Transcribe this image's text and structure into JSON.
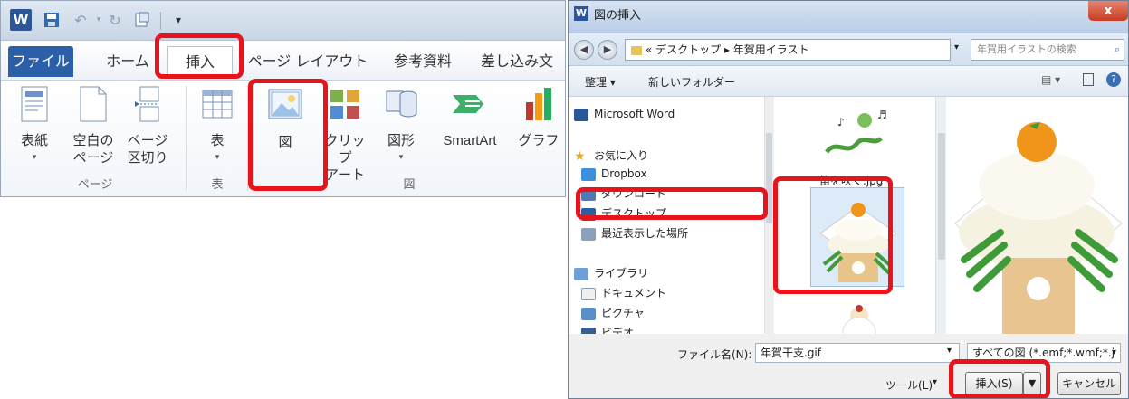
{
  "ribbon": {
    "qat": {
      "app_icon": "W",
      "save_icon": "save-icon",
      "undo_icon": "undo-icon",
      "redo_icon": "redo-icon"
    },
    "tabs": [
      {
        "label": "ファイル"
      },
      {
        "label": "ホーム"
      },
      {
        "label": "挿入"
      },
      {
        "label": "ページ レイアウト"
      },
      {
        "label": "参考資料"
      },
      {
        "label": "差し込み文"
      }
    ],
    "buttons": {
      "cover": "表紙",
      "blank_page_1": "空白の",
      "blank_page_2": "ページ",
      "page_break_1": "ページ",
      "page_break_2": "区切り",
      "table": "表",
      "picture": "図",
      "clipart_1": "クリップ",
      "clipart_2": "アート",
      "shapes": "図形",
      "smartart": "SmartArt",
      "chart": "グラフ"
    },
    "groups": {
      "pages": "ページ",
      "tables": "表",
      "illustrations": "図"
    },
    "colors": {
      "file_tab": "#2b5fa8",
      "highlight": "#e8141b"
    }
  },
  "dialog": {
    "title": "図の挿入",
    "close": "x",
    "address": "« デスクトップ ▸ 年賀用イラスト",
    "search_placeholder": "年賀用イラストの検索",
    "toolbar": {
      "organize": "整理 ▾",
      "new_folder": "新しいフォルダー"
    },
    "nav": {
      "word": "Microsoft Word",
      "favorites": "お気に入り",
      "dropbox": "Dropbox",
      "downloads": "ダウンロード",
      "desktop": "デスクトップ",
      "recent": "最近表示した場所",
      "libraries": "ライブラリ",
      "documents": "ドキュメント",
      "pictures": "ピクチャ",
      "videos": "ビデオ"
    },
    "files": {
      "file1_label": "笛を吹く.jpg"
    },
    "filename_label": "ファイル名(N):",
    "filename_value": "年賀干支.gif",
    "filter": "すべての図 (*.emf;*.wmf;*.j",
    "tools": "ツール(L)",
    "insert": "挿入(S)",
    "cancel": "キャンセル"
  }
}
